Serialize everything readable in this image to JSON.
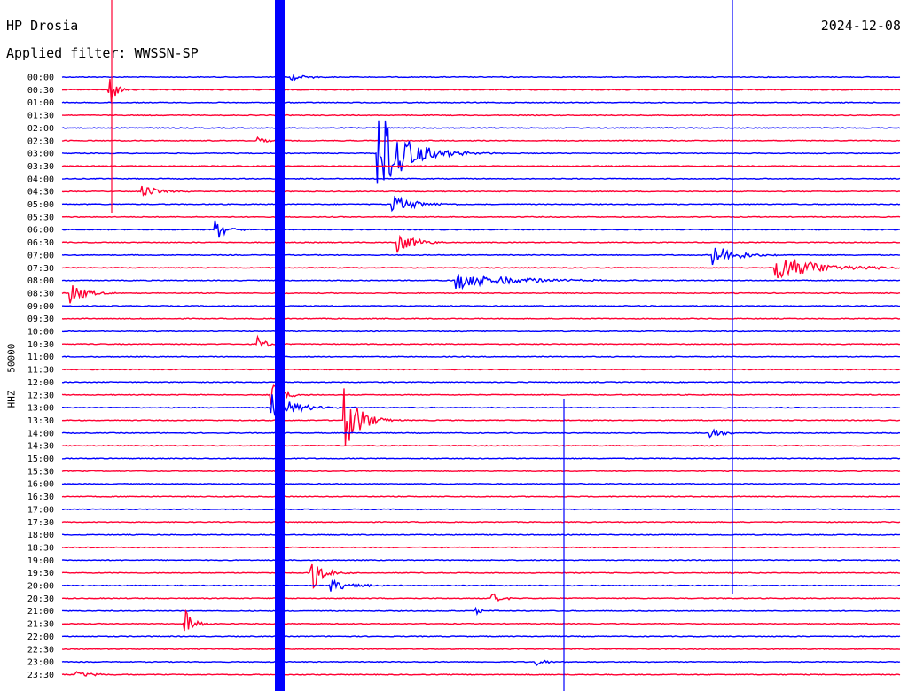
{
  "header": {
    "station": "HP Drosia",
    "date": "2024-12-08",
    "filter": "Applied filter: WWSSN-SP"
  },
  "chart_data": {
    "type": "line",
    "title": "HP Drosia",
    "ylabel": "HHZ - 50000",
    "date": "2024-12-08",
    "filter": "WWSSN-SP",
    "colors": {
      "blue": "#0000ff",
      "red": "#ff0033"
    },
    "rows": [
      {
        "time": "00:00",
        "color": "blue"
      },
      {
        "time": "00:30",
        "color": "red"
      },
      {
        "time": "01:00",
        "color": "blue"
      },
      {
        "time": "01:30",
        "color": "red"
      },
      {
        "time": "02:00",
        "color": "blue"
      },
      {
        "time": "02:30",
        "color": "red"
      },
      {
        "time": "03:00",
        "color": "blue"
      },
      {
        "time": "03:30",
        "color": "red"
      },
      {
        "time": "04:00",
        "color": "blue"
      },
      {
        "time": "04:30",
        "color": "red"
      },
      {
        "time": "05:00",
        "color": "blue"
      },
      {
        "time": "05:30",
        "color": "red"
      },
      {
        "time": "06:00",
        "color": "blue"
      },
      {
        "time": "06:30",
        "color": "red"
      },
      {
        "time": "07:00",
        "color": "blue"
      },
      {
        "time": "07:30",
        "color": "red"
      },
      {
        "time": "08:00",
        "color": "blue"
      },
      {
        "time": "08:30",
        "color": "red"
      },
      {
        "time": "09:00",
        "color": "blue"
      },
      {
        "time": "09:30",
        "color": "red"
      },
      {
        "time": "10:00",
        "color": "blue"
      },
      {
        "time": "10:30",
        "color": "red"
      },
      {
        "time": "11:00",
        "color": "blue"
      },
      {
        "time": "11:30",
        "color": "red"
      },
      {
        "time": "12:00",
        "color": "blue"
      },
      {
        "time": "12:30",
        "color": "red"
      },
      {
        "time": "13:00",
        "color": "blue"
      },
      {
        "time": "13:30",
        "color": "red"
      },
      {
        "time": "14:00",
        "color": "blue"
      },
      {
        "time": "14:30",
        "color": "red"
      },
      {
        "time": "15:00",
        "color": "blue"
      },
      {
        "time": "15:30",
        "color": "red"
      },
      {
        "time": "16:00",
        "color": "blue"
      },
      {
        "time": "16:30",
        "color": "red"
      },
      {
        "time": "17:00",
        "color": "blue"
      },
      {
        "time": "17:30",
        "color": "red"
      },
      {
        "time": "18:00",
        "color": "blue"
      },
      {
        "time": "18:30",
        "color": "red"
      },
      {
        "time": "19:00",
        "color": "blue"
      },
      {
        "time": "19:30",
        "color": "red"
      },
      {
        "time": "20:00",
        "color": "blue"
      },
      {
        "time": "20:30",
        "color": "red"
      },
      {
        "time": "21:00",
        "color": "blue"
      },
      {
        "time": "21:30",
        "color": "red"
      },
      {
        "time": "22:00",
        "color": "blue"
      },
      {
        "time": "22:30",
        "color": "red"
      },
      {
        "time": "23:00",
        "color": "blue"
      },
      {
        "time": "23:30",
        "color": "red"
      }
    ],
    "x_range_minutes": [
      0,
      30
    ],
    "events": [
      {
        "row": "00:00",
        "minute": 8.2,
        "amp": 0.4,
        "dur": 1.0
      },
      {
        "row": "00:30",
        "minute": 1.7,
        "amp": 2.2,
        "dur": 0.4
      },
      {
        "row": "02:30",
        "minute": 7.0,
        "amp": 0.6,
        "dur": 0.4
      },
      {
        "row": "03:00",
        "minute": 11.3,
        "amp": 5.5,
        "dur": 1.5
      },
      {
        "row": "04:30",
        "minute": 2.9,
        "amp": 0.8,
        "dur": 0.8
      },
      {
        "row": "05:00",
        "minute": 11.8,
        "amp": 1.2,
        "dur": 1.2
      },
      {
        "row": "06:00",
        "minute": 5.5,
        "amp": 1.4,
        "dur": 0.6
      },
      {
        "row": "06:30",
        "minute": 12.0,
        "amp": 1.3,
        "dur": 1.0
      },
      {
        "row": "07:00",
        "minute": 23.3,
        "amp": 1.6,
        "dur": 1.2
      },
      {
        "row": "07:30",
        "minute": 25.5,
        "amp": 1.6,
        "dur": 2.5
      },
      {
        "row": "08:00",
        "minute": 14.0,
        "amp": 1.2,
        "dur": 3.0
      },
      {
        "row": "08:30",
        "minute": 0.3,
        "amp": 1.4,
        "dur": 0.8
      },
      {
        "row": "10:30",
        "minute": 7.0,
        "amp": 1.4,
        "dur": 0.4
      },
      {
        "row": "12:30",
        "minute": 7.5,
        "amp": 1.6,
        "dur": 0.6
      },
      {
        "row": "13:00",
        "minute": 7.5,
        "amp": 1.8,
        "dur": 1.2
      },
      {
        "row": "13:30",
        "minute": 10.1,
        "amp": 4.5,
        "dur": 0.8
      },
      {
        "row": "14:00",
        "minute": 23.2,
        "amp": 0.8,
        "dur": 0.5
      },
      {
        "row": "19:30",
        "minute": 8.9,
        "amp": 2.5,
        "dur": 0.6
      },
      {
        "row": "20:00",
        "minute": 9.6,
        "amp": 0.8,
        "dur": 1.2
      },
      {
        "row": "20:30",
        "minute": 15.4,
        "amp": 0.7,
        "dur": 0.5
      },
      {
        "row": "21:00",
        "minute": 14.8,
        "amp": 0.4,
        "dur": 0.5
      },
      {
        "row": "21:30",
        "minute": 4.4,
        "amp": 1.8,
        "dur": 0.5
      },
      {
        "row": "23:00",
        "minute": 16.9,
        "amp": 0.6,
        "dur": 0.5
      },
      {
        "row": "23:30",
        "minute": 0.5,
        "amp": 0.4,
        "dur": 1.0
      }
    ]
  }
}
